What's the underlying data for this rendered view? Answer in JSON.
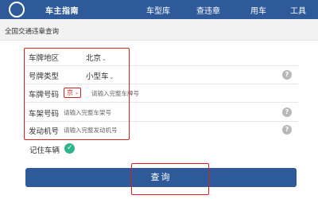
{
  "nav": {
    "brand": "车主指南",
    "items": [
      "车型库",
      "查违章",
      "用车",
      "工具"
    ]
  },
  "subtitle": "全国交通违章查询",
  "form": {
    "region": {
      "label": "车牌地区",
      "value": "北京"
    },
    "plate_type": {
      "label": "号牌类型",
      "value": "小型车"
    },
    "plate_number": {
      "label": "车牌号码",
      "province": "京",
      "placeholder": "请输入完整车牌号"
    },
    "frame_number": {
      "label": "车架号码",
      "placeholder": "请输入完整车架号"
    },
    "engine_number": {
      "label": "发动机号",
      "placeholder": "请输入完整发动机号"
    },
    "remember": {
      "label": "记住车辆",
      "checked": true
    }
  },
  "help_icon_text": "?",
  "query_button": "查询",
  "colors": {
    "nav_bg": "#2f5a9a",
    "highlight": "#e02020",
    "check": "#2fb48a"
  }
}
